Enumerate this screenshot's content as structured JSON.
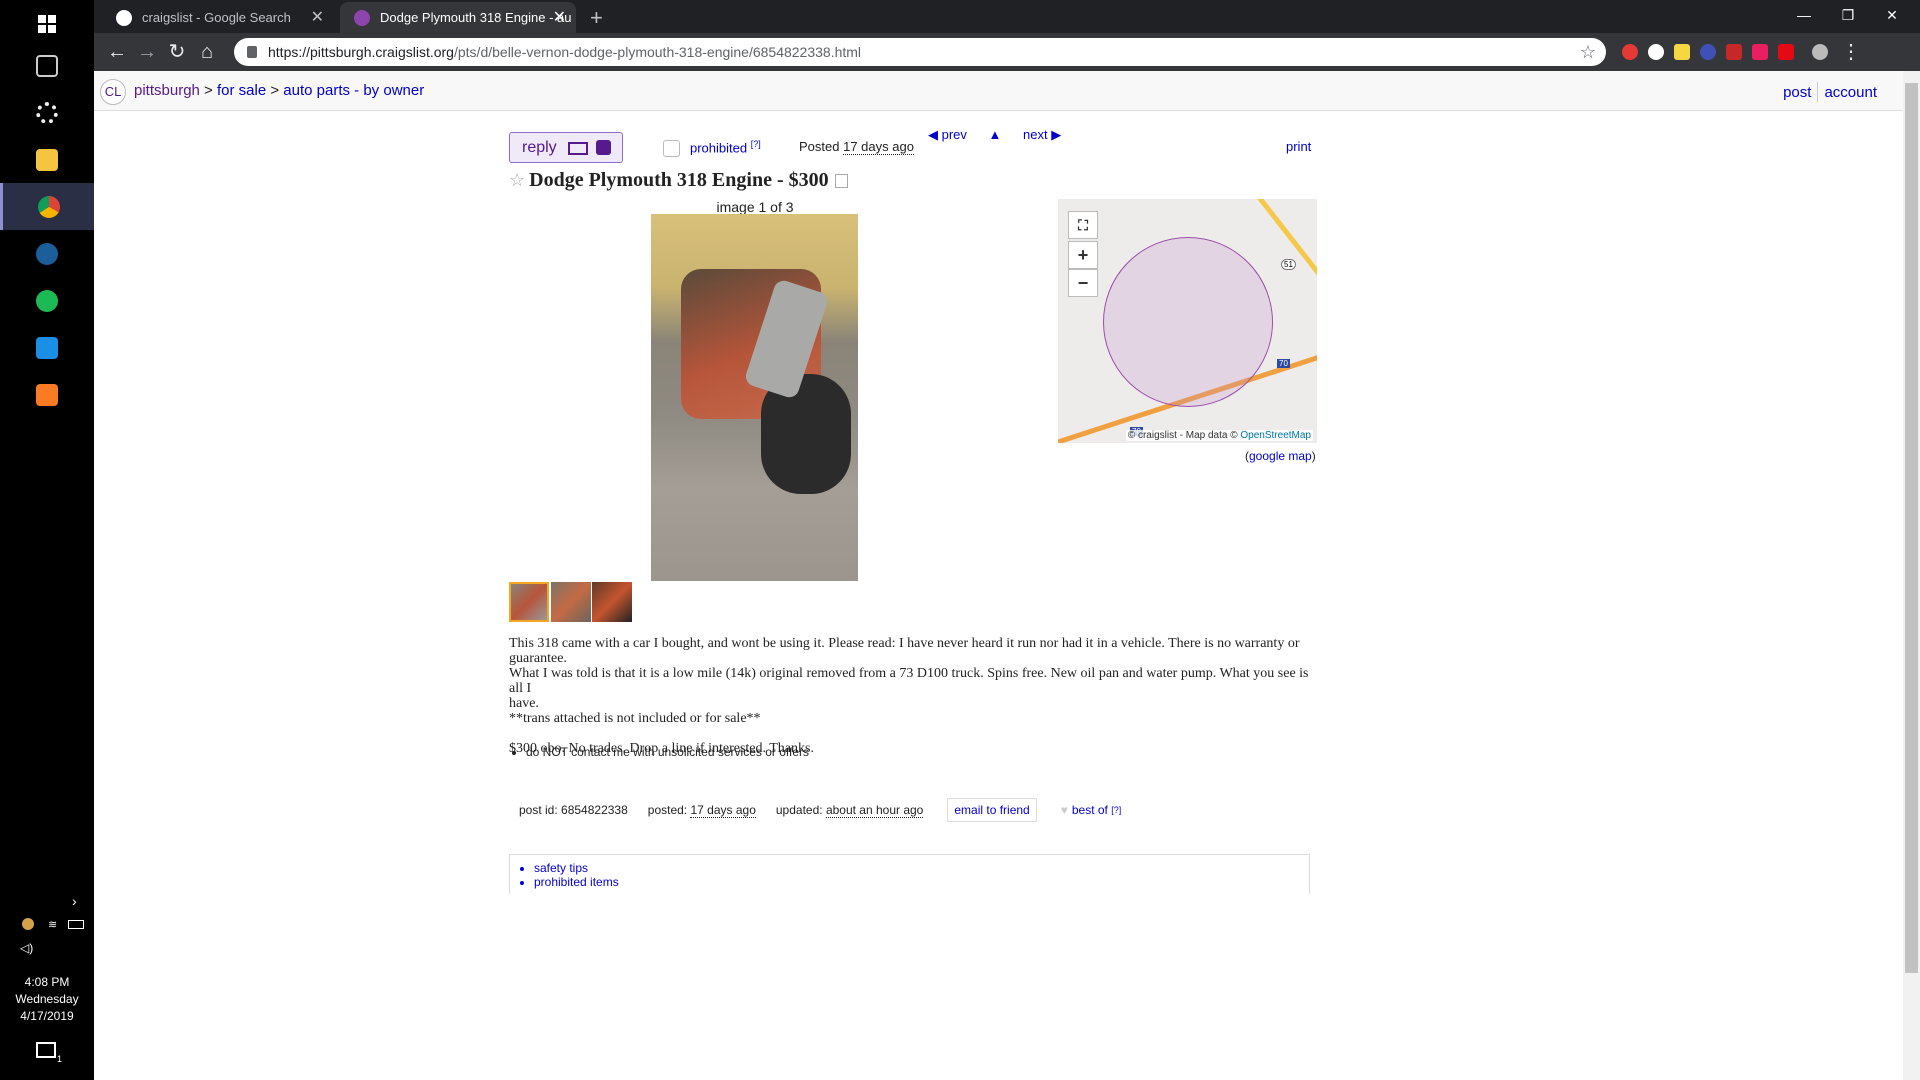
{
  "taskbar": {
    "clock_time": "4:08 PM",
    "clock_day": "Wednesday",
    "clock_date": "4/17/2019",
    "notif_count": "1"
  },
  "browser": {
    "tabs": [
      {
        "label": "craigslist - Google Search",
        "favicon_color": "#4285f4"
      },
      {
        "label": "Dodge Plymouth 318 Engine - au",
        "favicon_color": "#8e44ad"
      }
    ],
    "url_host": "https://pittsburgh.craigslist.org",
    "url_path": "/pts/d/belle-vernon-dodge-plymouth-318-engine/6854822338.html"
  },
  "header": {
    "logo": "CL",
    "breadcrumbs": [
      "pittsburgh",
      "for sale",
      "auto parts - by owner"
    ],
    "separator": ">",
    "post": "post",
    "account": "account"
  },
  "pager": {
    "prev": "◀ prev",
    "up": "▲",
    "next": "next ▶"
  },
  "actions": {
    "reply": "reply",
    "prohibited": "prohibited",
    "prohibited_help": "[?]",
    "posted_label": "Posted",
    "posted_value": "17 days ago",
    "print": "print"
  },
  "posting": {
    "title": "Dodge Plymouth 318 Engine - $300",
    "image_count": "image 1 of 3",
    "body_lines": [
      "This 318 came with a car I bought, and wont be using it. Please read: I have never heard it run nor had it in a vehicle. There is no warranty or guarantee.",
      "What I was told is that it is a low mile (14k) original removed from a 73 D100 truck. Spins free. New oil pan and water pump. What you see is all I",
      "have.",
      "**trans attached is not included or for sale**",
      "",
      "$300 obo. No trades. Drop a line if interested. Thanks."
    ],
    "notices": [
      "do NOT contact me with unsolicited services or offers"
    ]
  },
  "map": {
    "attribution_prefix": "© craigslist - Map data ©",
    "attribution_link": "OpenStreetMap",
    "google_map": "google map",
    "google_map_open": "(",
    "google_map_close": ")",
    "zoom_in": "+",
    "zoom_out": "−",
    "fullscreen": "⛶",
    "highway_labels": [
      "51",
      "70",
      "70"
    ]
  },
  "postinfo": {
    "post_id": "post id: 6854822338",
    "posted_label": "posted:",
    "posted_value": "17 days ago",
    "updated_label": "updated:",
    "updated_value": "about an hour ago",
    "email_friend": "email to friend",
    "best_of": "best of",
    "best_of_help": "[?]"
  },
  "footer": {
    "links": [
      "safety tips",
      "prohibited items"
    ]
  }
}
